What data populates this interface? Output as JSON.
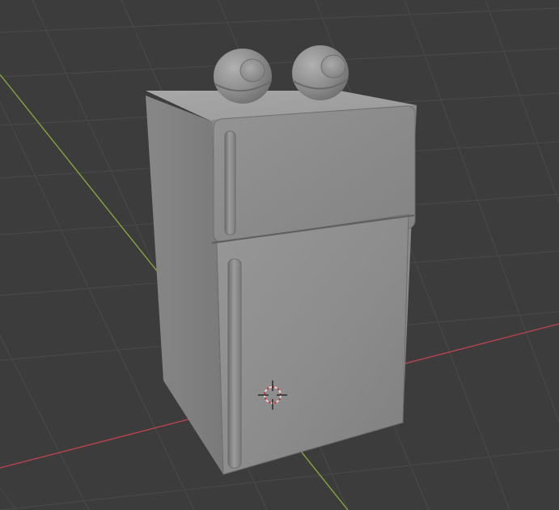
{
  "viewport": {
    "background": "#3c3c3c",
    "grid_color": "#4a4a4a",
    "x_axis_color": "#b8434f",
    "y_axis_color": "#84a63b"
  },
  "scene": {
    "object": "refrigerator",
    "material_color": "#8e8e8e",
    "top_ornaments": [
      "eyeball",
      "eyeball"
    ],
    "cursor": "3d-cursor-icon"
  }
}
